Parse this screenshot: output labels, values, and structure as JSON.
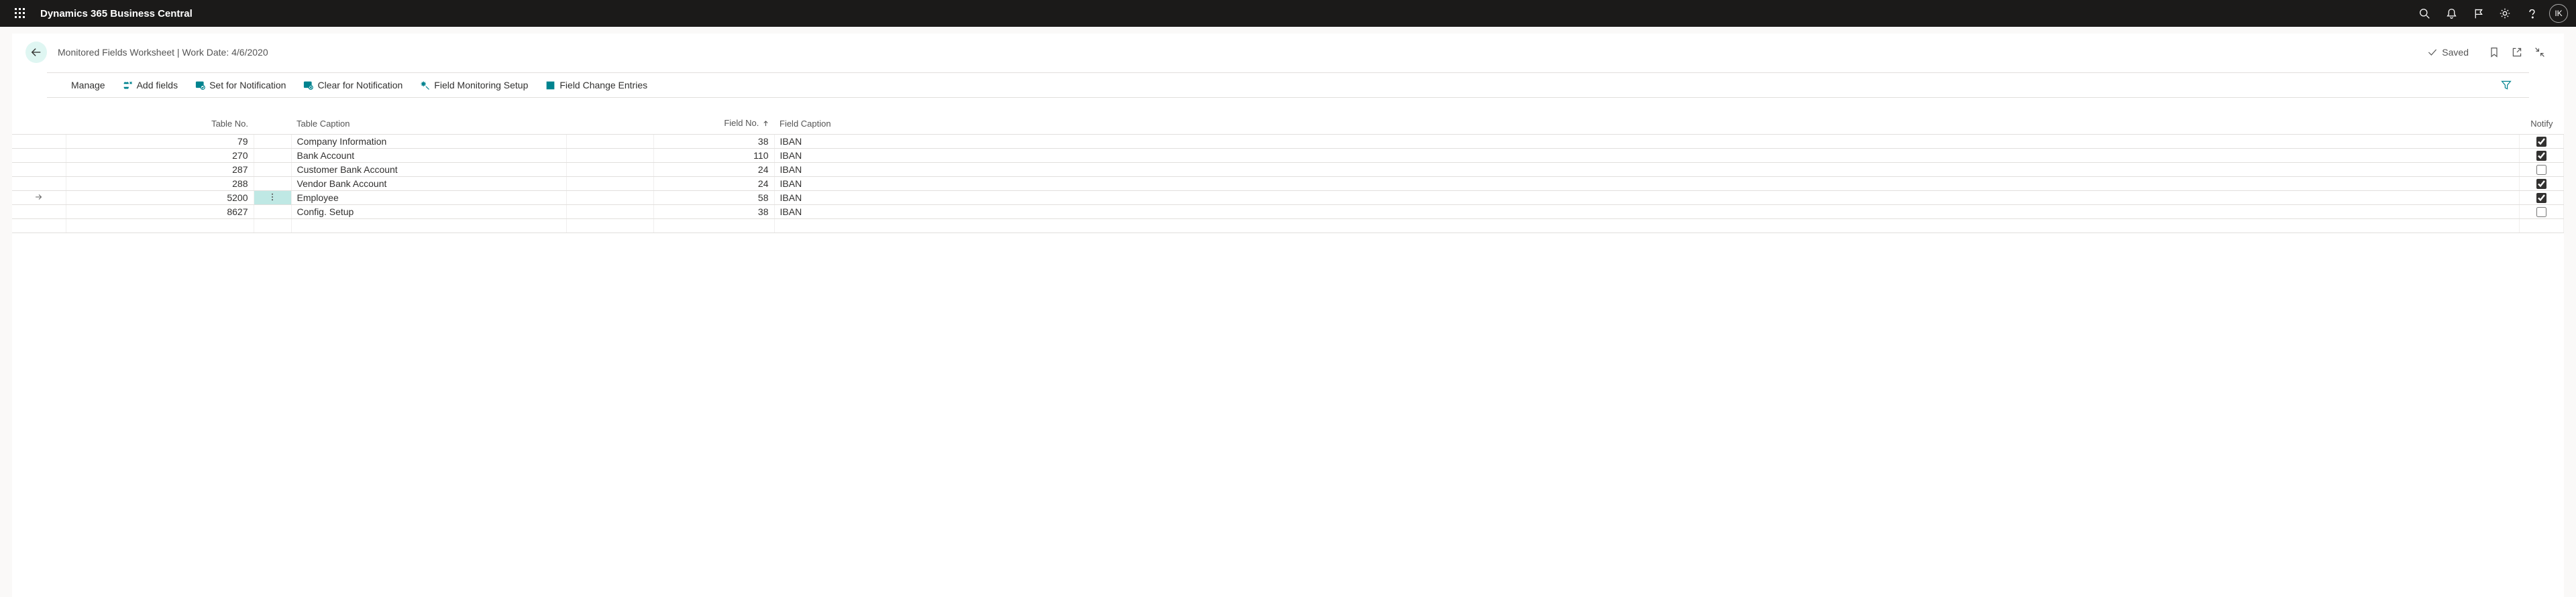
{
  "topbar": {
    "product": "Dynamics 365 Business Central",
    "user_initials": "IK"
  },
  "page": {
    "title": "Monitored Fields Worksheet | Work Date: 4/6/2020",
    "saved_label": "Saved"
  },
  "toolbar": {
    "manage": "Manage",
    "add_fields": "Add fields",
    "set_notification": "Set for Notification",
    "clear_notification": "Clear for Notification",
    "field_monitoring_setup": "Field Monitoring Setup",
    "field_change_entries": "Field Change Entries"
  },
  "table": {
    "columns": {
      "table_no": "Table No.",
      "table_caption": "Table Caption",
      "field_no": "Field No.",
      "field_caption": "Field Caption",
      "notify": "Notify"
    },
    "rows": [
      {
        "table_no": "79",
        "table_caption": "Company Information",
        "field_no": "38",
        "field_caption": "IBAN",
        "notify": true,
        "active": false
      },
      {
        "table_no": "270",
        "table_caption": "Bank Account",
        "field_no": "110",
        "field_caption": "IBAN",
        "notify": true,
        "active": false
      },
      {
        "table_no": "287",
        "table_caption": "Customer Bank Account",
        "field_no": "24",
        "field_caption": "IBAN",
        "notify": false,
        "active": false
      },
      {
        "table_no": "288",
        "table_caption": "Vendor Bank Account",
        "field_no": "24",
        "field_caption": "IBAN",
        "notify": true,
        "active": false
      },
      {
        "table_no": "5200",
        "table_caption": "Employee",
        "field_no": "58",
        "field_caption": "IBAN",
        "notify": true,
        "active": true
      },
      {
        "table_no": "8627",
        "table_caption": "Config. Setup",
        "field_no": "38",
        "field_caption": "IBAN",
        "notify": false,
        "active": false
      }
    ]
  }
}
